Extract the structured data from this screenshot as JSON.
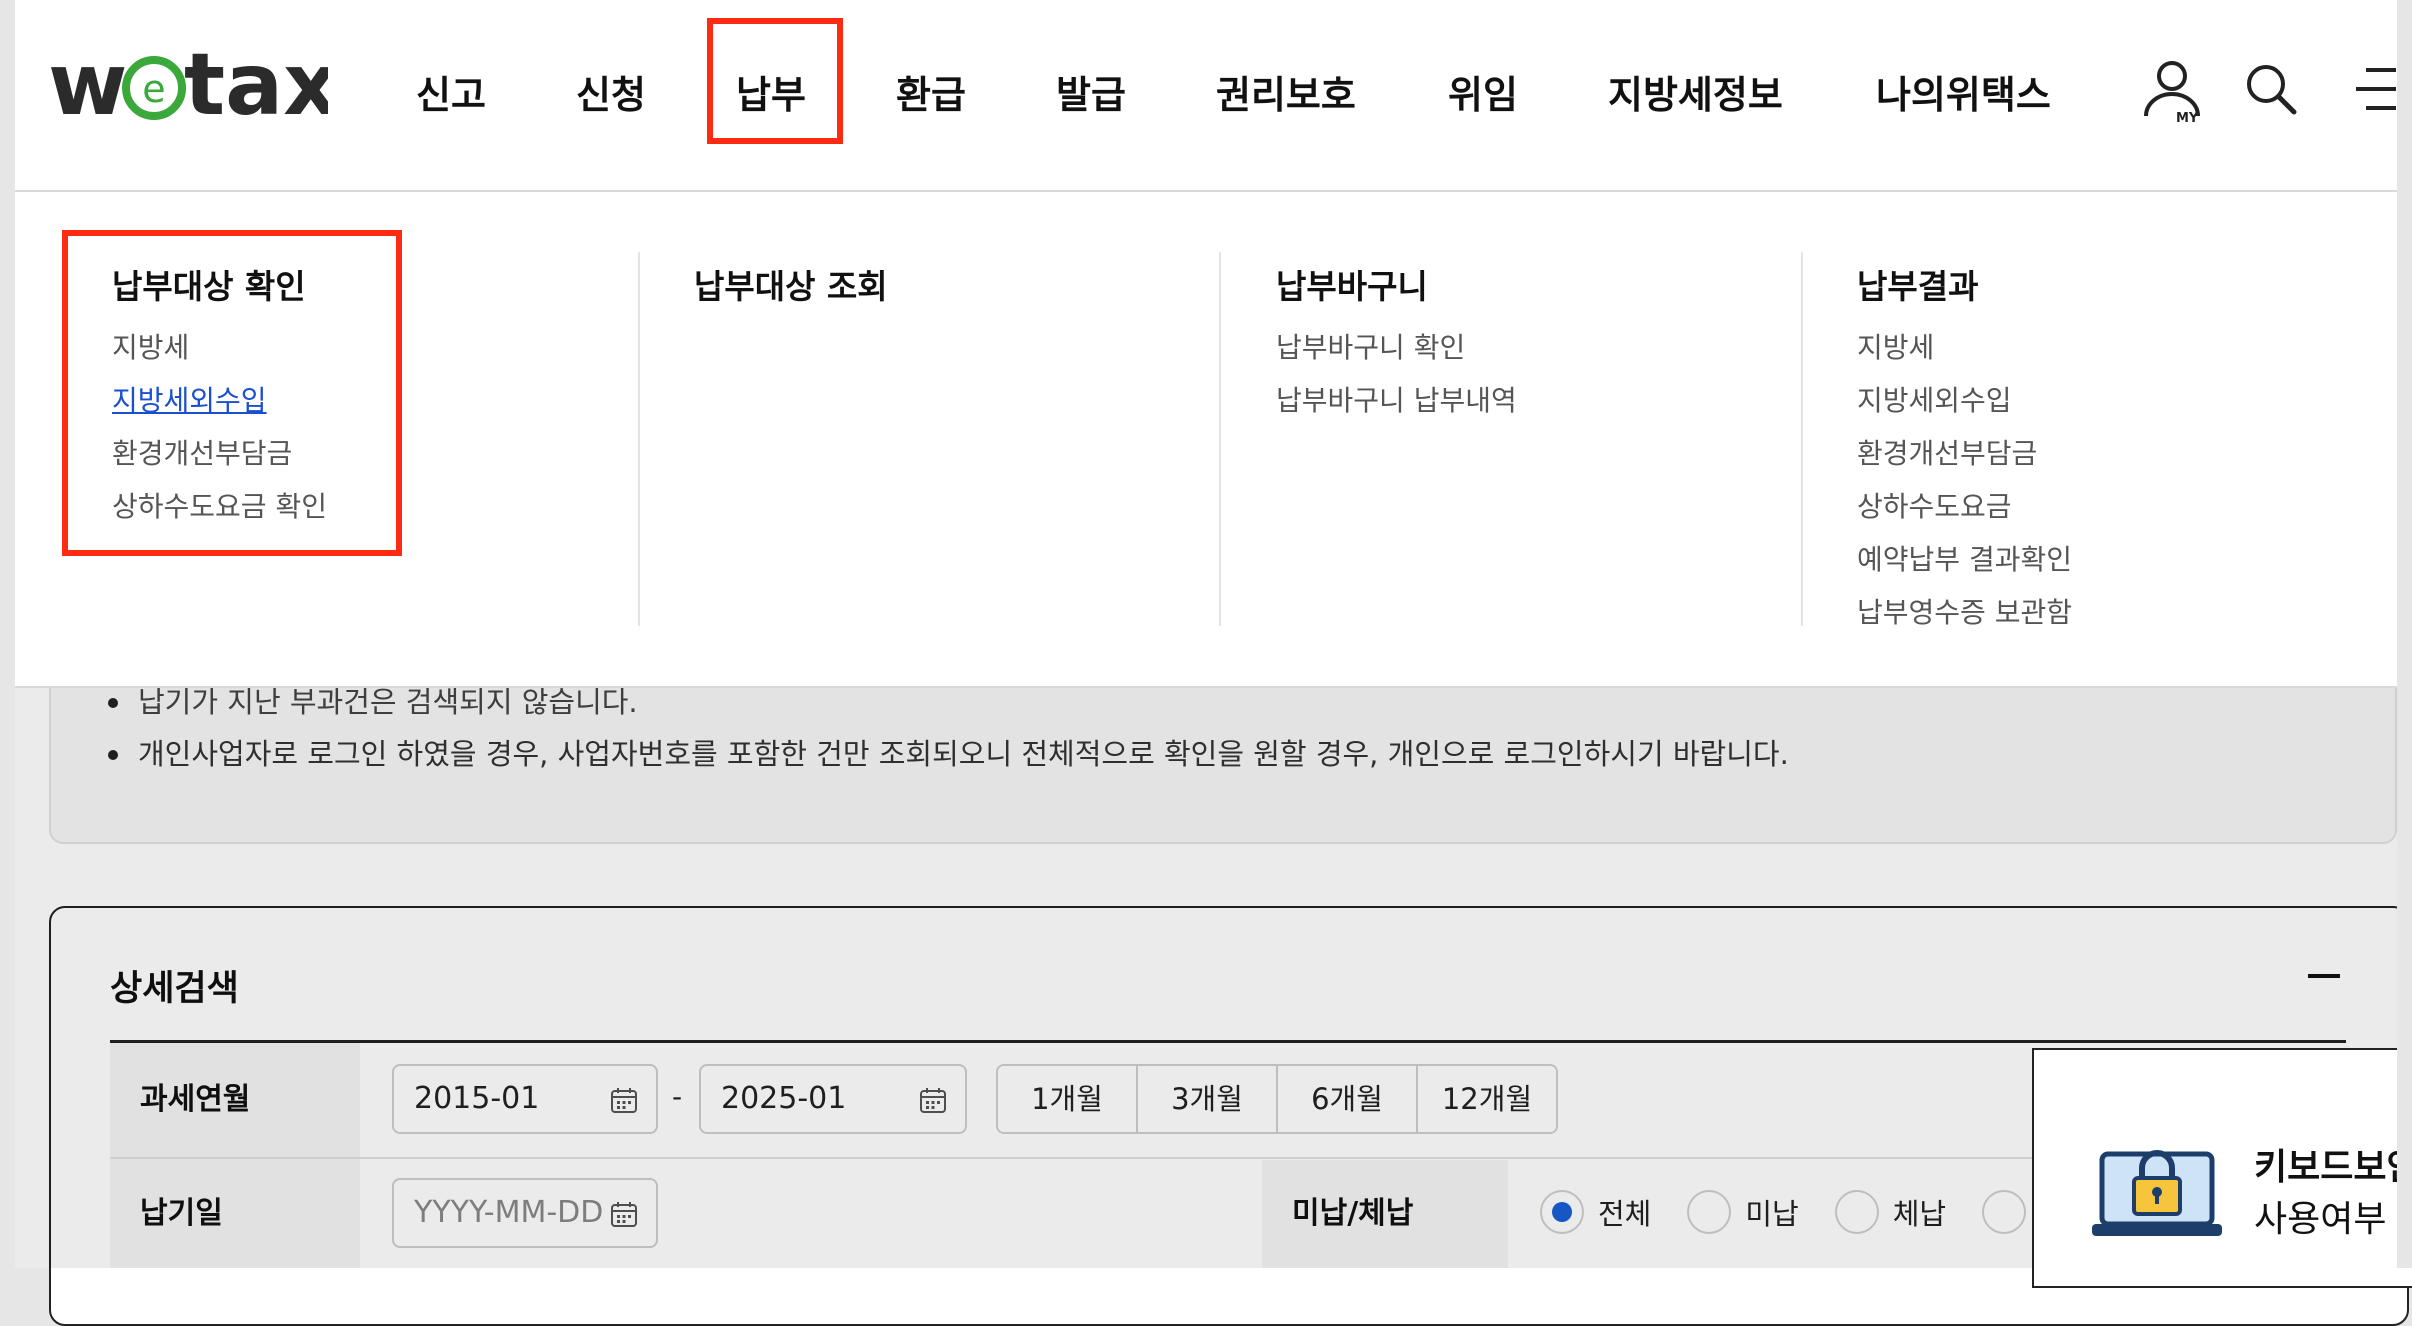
{
  "brand": {
    "logo_pre": "w",
    "logo_e": "e",
    "logo_post": "tax"
  },
  "nav": {
    "items": [
      "신고",
      "신청",
      "납부",
      "환급",
      "발급",
      "권리보호",
      "위임",
      "지방세정보",
      "나의위택스"
    ],
    "active_index": 2,
    "my_label": "MY"
  },
  "mega_menu": {
    "columns": [
      {
        "title": "납부대상 확인",
        "items": [
          "지방세",
          "지방세외수입",
          "환경개선부담금",
          "상하수도요금 확인"
        ]
      },
      {
        "title": "납부대상 조회",
        "items": []
      },
      {
        "title": "납부바구니",
        "items": [
          "납부바구니 확인",
          "납부바구니 납부내역"
        ]
      },
      {
        "title": "납부결과",
        "items": [
          "지방세",
          "지방세외수입",
          "환경개선부담금",
          "상하수도요금",
          "예약납부 결과확인",
          "납부영수증 보관함"
        ]
      }
    ],
    "active_item": "지방세외수입"
  },
  "notice": {
    "items": [
      "납기가 지난 부과건은 검색되지 않습니다.",
      "개인사업자로 로그인 하였을 경우, 사업자번호를 포함한 건만 조회되오니 전체적으로 확인을 원할 경우, 개인으로 로그인하시기 바랍니다."
    ]
  },
  "search": {
    "title": "상세검색",
    "tax_period_label": "과세연월",
    "from_value": "2015-01",
    "to_value": "2025-01",
    "separator": "-",
    "period_buttons": [
      "1개월",
      "3개월",
      "6개월",
      "12개월"
    ],
    "due_date_label": "납기일",
    "due_date_placeholder": "YYYY-MM-DD",
    "status_label": "미납/체납",
    "status_options": [
      "전체",
      "미납",
      "체납"
    ],
    "status_selected": "전체"
  },
  "keyboard_security": {
    "title": "키보드보안",
    "subtitle": "사용여부 선택"
  },
  "colors": {
    "highlight": "#ff2a12",
    "link": "#1a4fd0",
    "logo_green": "#3aa83a",
    "radio_on": "#1a5fd6"
  }
}
